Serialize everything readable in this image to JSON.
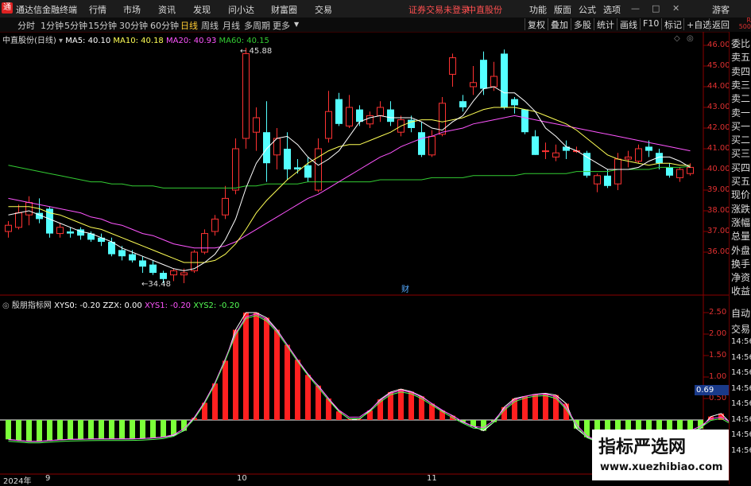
{
  "app": {
    "title": "通达信金融终端",
    "menu": [
      "行情",
      "市场",
      "资讯",
      "发现",
      "问小达",
      "财富圈",
      "交易"
    ],
    "center_notice": "证券交易未登录",
    "stock_name_top": "中直股份",
    "right_menu": [
      "功能",
      "版面",
      "公式",
      "选项"
    ],
    "user": "游客",
    "corner_r": "R",
    "corner_num": "500"
  },
  "toolbar": {
    "periods": [
      "分时",
      "1分钟",
      "5分钟",
      "15分钟",
      "30分钟",
      "60分钟",
      "日线",
      "周线",
      "月线",
      "多周期",
      "更多"
    ],
    "active_period": "日线",
    "right_buttons": [
      "复权",
      "叠加",
      "多股",
      "统计",
      "画线",
      "F10",
      "标记",
      "+自选",
      "返回"
    ]
  },
  "main_legend": {
    "stock": "中直股份(日线)",
    "ma5": "MA5: 40.10",
    "ma10": "MA10: 40.18",
    "ma20": "MA20: 40.93",
    "ma60": "MA60: 40.15"
  },
  "colors": {
    "up": "#ff3232",
    "down": "#54ffff",
    "ma5": "#ffffff",
    "ma10": "#ffff55",
    "ma20": "#ff55ff",
    "ma60": "#33cc33",
    "ind_pos": "#ff2020",
    "ind_neg": "#7cff3a"
  },
  "annotations": {
    "high": "45.88",
    "low": "34.48",
    "cai": "财"
  },
  "indicator_legend": {
    "name": "殷朋指标网",
    "xys0": "XYS0: -0.20",
    "zzx": "ZZX: 0.00",
    "xys1": "XYS1: -0.20",
    "xys2": "XYS2: -0.20"
  },
  "price_axis": [
    "46.00",
    "45.00",
    "44.00",
    "43.00",
    "42.00",
    "41.00",
    "40.00",
    "39.00",
    "38.00",
    "37.00",
    "36.00"
  ],
  "ind_axis": [
    "2.50",
    "2.00",
    "1.50",
    "1.00",
    "0.50"
  ],
  "ind_axis_highlight": "0.69",
  "right_panel": {
    "top_items": [
      "委比",
      "卖五",
      "卖四",
      "卖三",
      "卖二",
      "卖一",
      "买一",
      "买二",
      "买三",
      "买四",
      "买五",
      "现价",
      "涨跌",
      "涨幅",
      "总量",
      "外盘",
      "换手",
      "净资",
      "收益"
    ],
    "bottom_items": [
      "自动",
      "交易",
      "14:56",
      "14:56",
      "14:56",
      "14:56",
      "14:56",
      "14:56",
      "14:56",
      "14:56"
    ]
  },
  "x_axis": {
    "labels": [
      "2024年",
      "9",
      "10",
      "11"
    ]
  },
  "watermark": {
    "line1": "指标严选网",
    "line2": "www.xuezhibiao.com"
  },
  "chart_data": {
    "type": "candlestick",
    "y_range": [
      34.0,
      46.5
    ],
    "candles": [
      {
        "o": 37.0,
        "h": 37.5,
        "l": 36.7,
        "c": 37.3
      },
      {
        "o": 37.2,
        "h": 38.3,
        "l": 37.1,
        "c": 37.9
      },
      {
        "o": 37.8,
        "h": 38.7,
        "l": 37.3,
        "c": 38.4
      },
      {
        "o": 37.9,
        "h": 38.6,
        "l": 37.4,
        "c": 37.6
      },
      {
        "o": 38.1,
        "h": 38.2,
        "l": 36.7,
        "c": 36.9
      },
      {
        "o": 36.9,
        "h": 37.4,
        "l": 36.7,
        "c": 37.2
      },
      {
        "o": 37.0,
        "h": 37.2,
        "l": 36.7,
        "c": 36.9
      },
      {
        "o": 37.1,
        "h": 37.2,
        "l": 36.6,
        "c": 36.8
      },
      {
        "o": 36.9,
        "h": 37.0,
        "l": 36.5,
        "c": 36.6
      },
      {
        "o": 36.7,
        "h": 36.9,
        "l": 36.3,
        "c": 36.5
      },
      {
        "o": 36.5,
        "h": 36.7,
        "l": 35.8,
        "c": 35.9
      },
      {
        "o": 36.1,
        "h": 36.3,
        "l": 35.6,
        "c": 35.8
      },
      {
        "o": 35.9,
        "h": 36.1,
        "l": 35.5,
        "c": 35.6
      },
      {
        "o": 35.6,
        "h": 35.8,
        "l": 35.0,
        "c": 35.3
      },
      {
        "o": 35.4,
        "h": 35.6,
        "l": 34.9,
        "c": 35.0
      },
      {
        "o": 35.0,
        "h": 35.1,
        "l": 34.5,
        "c": 34.7
      },
      {
        "o": 34.9,
        "h": 35.2,
        "l": 34.6,
        "c": 35.1
      },
      {
        "o": 34.9,
        "h": 35.2,
        "l": 34.5,
        "c": 35.0
      },
      {
        "o": 35.1,
        "h": 36.1,
        "l": 35.0,
        "c": 36.0
      },
      {
        "o": 36.0,
        "h": 37.1,
        "l": 35.9,
        "c": 36.9
      },
      {
        "o": 37.0,
        "h": 37.8,
        "l": 36.8,
        "c": 37.6
      },
      {
        "o": 37.8,
        "h": 39.2,
        "l": 37.6,
        "c": 38.6
      },
      {
        "o": 39.0,
        "h": 41.5,
        "l": 38.8,
        "c": 41.0
      },
      {
        "o": 41.5,
        "h": 45.88,
        "l": 41.0,
        "c": 45.6
      },
      {
        "o": 41.8,
        "h": 43.0,
        "l": 40.9,
        "c": 42.5
      },
      {
        "o": 41.8,
        "h": 43.3,
        "l": 39.4,
        "c": 40.3
      },
      {
        "o": 40.7,
        "h": 42.0,
        "l": 40.0,
        "c": 41.5
      },
      {
        "o": 41.0,
        "h": 41.8,
        "l": 39.5,
        "c": 40.0
      },
      {
        "o": 40.1,
        "h": 40.5,
        "l": 39.8,
        "c": 40.0
      },
      {
        "o": 40.2,
        "h": 40.6,
        "l": 39.4,
        "c": 39.6
      },
      {
        "o": 39.0,
        "h": 41.5,
        "l": 38.9,
        "c": 41.0
      },
      {
        "o": 41.5,
        "h": 43.8,
        "l": 41.3,
        "c": 42.8
      },
      {
        "o": 43.4,
        "h": 43.7,
        "l": 42.1,
        "c": 42.2
      },
      {
        "o": 42.1,
        "h": 43.6,
        "l": 42.0,
        "c": 43.0
      },
      {
        "o": 42.9,
        "h": 43.1,
        "l": 42.1,
        "c": 42.3
      },
      {
        "o": 42.2,
        "h": 42.8,
        "l": 42.0,
        "c": 42.6
      },
      {
        "o": 42.6,
        "h": 43.3,
        "l": 42.3,
        "c": 43.0
      },
      {
        "o": 42.9,
        "h": 43.3,
        "l": 42.1,
        "c": 42.3
      },
      {
        "o": 41.8,
        "h": 42.6,
        "l": 41.6,
        "c": 42.4
      },
      {
        "o": 42.4,
        "h": 42.6,
        "l": 41.8,
        "c": 42.0
      },
      {
        "o": 41.8,
        "h": 42.3,
        "l": 40.6,
        "c": 40.7
      },
      {
        "o": 40.7,
        "h": 41.9,
        "l": 40.6,
        "c": 41.6
      },
      {
        "o": 41.7,
        "h": 43.5,
        "l": 41.6,
        "c": 43.2
      },
      {
        "o": 44.6,
        "h": 45.6,
        "l": 44.0,
        "c": 45.4
      },
      {
        "o": 43.3,
        "h": 43.6,
        "l": 42.8,
        "c": 43.0
      },
      {
        "o": 44.0,
        "h": 45.0,
        "l": 43.6,
        "c": 44.2
      },
      {
        "o": 45.3,
        "h": 45.7,
        "l": 43.6,
        "c": 43.9
      },
      {
        "o": 44.0,
        "h": 45.2,
        "l": 43.8,
        "c": 44.5
      },
      {
        "o": 45.6,
        "h": 45.8,
        "l": 42.9,
        "c": 43.0
      },
      {
        "o": 43.4,
        "h": 43.5,
        "l": 42.7,
        "c": 43.1
      },
      {
        "o": 42.9,
        "h": 42.9,
        "l": 41.7,
        "c": 41.8
      },
      {
        "o": 41.6,
        "h": 41.9,
        "l": 40.7,
        "c": 40.7
      },
      {
        "o": 40.9,
        "h": 41.3,
        "l": 40.5,
        "c": 40.9
      },
      {
        "o": 40.6,
        "h": 41.2,
        "l": 40.4,
        "c": 40.8
      },
      {
        "o": 41.1,
        "h": 41.4,
        "l": 40.5,
        "c": 40.9
      },
      {
        "o": 40.9,
        "h": 41.1,
        "l": 40.8,
        "c": 40.9
      },
      {
        "o": 40.8,
        "h": 40.9,
        "l": 39.6,
        "c": 39.7
      },
      {
        "o": 39.3,
        "h": 39.8,
        "l": 38.9,
        "c": 39.7
      },
      {
        "o": 39.7,
        "h": 40.0,
        "l": 39.1,
        "c": 39.2
      },
      {
        "o": 39.3,
        "h": 40.8,
        "l": 39.0,
        "c": 40.5
      },
      {
        "o": 40.5,
        "h": 40.9,
        "l": 40.1,
        "c": 40.6
      },
      {
        "o": 40.4,
        "h": 41.2,
        "l": 40.3,
        "c": 41.0
      },
      {
        "o": 41.1,
        "h": 41.4,
        "l": 40.6,
        "c": 40.9
      },
      {
        "o": 40.8,
        "h": 41.0,
        "l": 40.0,
        "c": 40.3
      },
      {
        "o": 40.1,
        "h": 40.3,
        "l": 39.6,
        "c": 39.7
      },
      {
        "o": 39.6,
        "h": 40.1,
        "l": 39.4,
        "c": 40.0
      },
      {
        "o": 39.8,
        "h": 40.3,
        "l": 39.7,
        "c": 40.1
      }
    ],
    "ma5": [
      37.8,
      37.9,
      38.0,
      37.8,
      37.6,
      37.4,
      37.2,
      37.0,
      36.9,
      36.7,
      36.5,
      36.2,
      36.0,
      35.8,
      35.6,
      35.4,
      35.2,
      35.1,
      35.2,
      35.5,
      35.9,
      36.6,
      37.6,
      39.1,
      40.3,
      41.0,
      41.5,
      41.6,
      41.2,
      40.6,
      40.2,
      40.5,
      40.9,
      41.6,
      42.3,
      42.5,
      42.6,
      42.5,
      42.5,
      42.5,
      42.3,
      42.0,
      41.9,
      42.3,
      42.6,
      43.3,
      43.9,
      44.0,
      43.7,
      43.7,
      43.3,
      42.8,
      42.0,
      41.6,
      41.1,
      40.9,
      40.6,
      40.3,
      40.0,
      40.0,
      40.0,
      40.1,
      40.4,
      40.6,
      40.6,
      40.4,
      40.1
    ],
    "ma10": [
      38.2,
      38.2,
      38.2,
      38.1,
      37.9,
      37.8,
      37.6,
      37.4,
      37.2,
      37.1,
      36.9,
      36.7,
      36.5,
      36.3,
      36.1,
      35.9,
      35.7,
      35.5,
      35.5,
      35.5,
      35.6,
      35.9,
      36.4,
      37.1,
      37.9,
      38.5,
      39.0,
      39.5,
      39.9,
      40.3,
      40.6,
      40.9,
      41.1,
      41.2,
      41.2,
      41.4,
      41.6,
      41.8,
      42.1,
      42.3,
      42.4,
      42.4,
      42.3,
      42.4,
      42.5,
      42.7,
      42.9,
      43.0,
      43.0,
      43.0,
      42.9,
      42.8,
      42.6,
      42.4,
      42.2,
      41.9,
      41.5,
      41.1,
      40.7,
      40.5,
      40.4,
      40.3,
      40.2,
      40.3,
      40.3,
      40.2,
      40.2
    ],
    "ma20": [
      38.6,
      38.5,
      38.4,
      38.3,
      38.2,
      38.1,
      38.0,
      37.9,
      37.7,
      37.6,
      37.4,
      37.3,
      37.1,
      36.9,
      36.8,
      36.6,
      36.4,
      36.3,
      36.2,
      36.2,
      36.2,
      36.3,
      36.5,
      36.8,
      37.1,
      37.4,
      37.7,
      38.0,
      38.3,
      38.6,
      38.8,
      39.1,
      39.4,
      39.7,
      40.0,
      40.3,
      40.6,
      40.8,
      41.1,
      41.3,
      41.5,
      41.6,
      41.8,
      41.9,
      42.0,
      42.2,
      42.3,
      42.4,
      42.5,
      42.6,
      42.5,
      42.4,
      42.3,
      42.2,
      42.1,
      42.0,
      41.9,
      41.8,
      41.7,
      41.6,
      41.5,
      41.4,
      41.3,
      41.2,
      41.1,
      41.0,
      40.9
    ],
    "ma60": [
      40.2,
      40.1,
      40.0,
      39.9,
      39.8,
      39.7,
      39.6,
      39.5,
      39.4,
      39.4,
      39.3,
      39.3,
      39.2,
      39.2,
      39.2,
      39.1,
      39.1,
      39.1,
      39.1,
      39.1,
      39.1,
      39.1,
      39.1,
      39.2,
      39.2,
      39.3,
      39.3,
      39.3,
      39.3,
      39.4,
      39.4,
      39.4,
      39.4,
      39.4,
      39.4,
      39.4,
      39.5,
      39.5,
      39.5,
      39.5,
      39.5,
      39.6,
      39.6,
      39.6,
      39.6,
      39.7,
      39.7,
      39.7,
      39.7,
      39.7,
      39.8,
      39.8,
      39.8,
      39.8,
      39.8,
      39.9,
      39.9,
      39.9,
      39.9,
      40.0,
      40.0,
      40.0,
      40.0,
      40.1,
      40.1,
      40.1,
      40.15
    ],
    "indicator": {
      "y_range": [
        -0.55,
        2.7
      ],
      "bars": [
        -0.45,
        -0.48,
        -0.5,
        -0.5,
        -0.48,
        -0.46,
        -0.45,
        -0.45,
        -0.44,
        -0.44,
        -0.44,
        -0.44,
        -0.44,
        -0.43,
        -0.42,
        -0.4,
        -0.36,
        -0.25,
        0.05,
        0.4,
        0.85,
        1.38,
        2.1,
        2.5,
        2.5,
        2.38,
        2.1,
        1.75,
        1.4,
        1.05,
        0.8,
        0.5,
        0.2,
        0.02,
        0.02,
        0.22,
        0.48,
        0.65,
        0.72,
        0.66,
        0.55,
        0.38,
        0.22,
        0.1,
        -0.05,
        -0.15,
        -0.25,
        -0.05,
        0.3,
        0.5,
        0.55,
        0.6,
        0.62,
        0.58,
        0.38,
        -0.2,
        -0.4,
        -0.5,
        -0.5,
        -0.48,
        -0.46,
        -0.44,
        -0.44,
        -0.4,
        -0.35,
        -0.3,
        -0.25,
        -0.2,
        0.08,
        0.15,
        -0.1,
        -0.2
      ]
    }
  }
}
